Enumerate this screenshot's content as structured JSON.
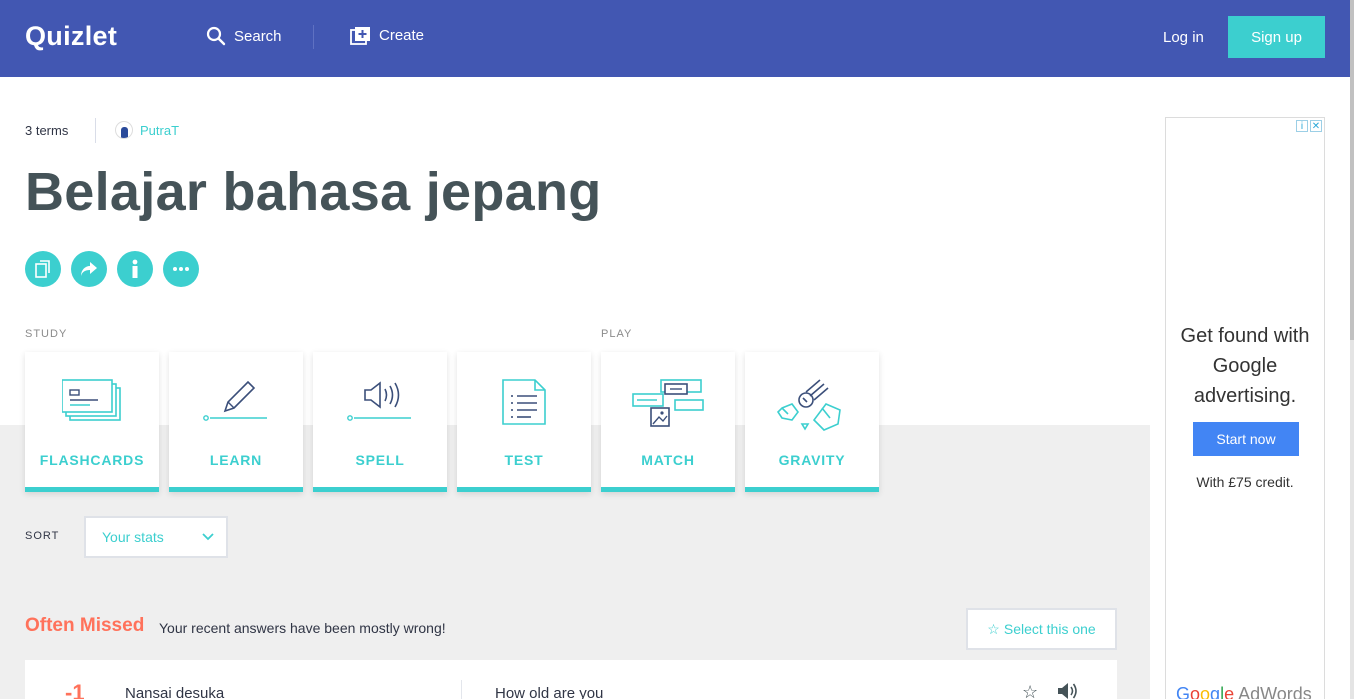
{
  "header": {
    "logo": "Quizlet",
    "search_label": "Search",
    "create_label": "Create",
    "login_label": "Log in",
    "signup_label": "Sign up"
  },
  "set": {
    "terms_count": "3 terms",
    "author": "PutraT",
    "title": "Belajar bahasa jepang"
  },
  "sections": {
    "study": "STUDY",
    "play": "PLAY"
  },
  "modes": {
    "flashcards": "FLASHCARDS",
    "learn": "LEARN",
    "spell": "SPELL",
    "test": "TEST",
    "match": "MATCH",
    "gravity": "GRAVITY"
  },
  "sort": {
    "label": "SORT",
    "selected": "Your stats"
  },
  "often_missed": {
    "title": "Often Missed",
    "subtitle": "Your recent answers have been mostly wrong!",
    "select_button": "Select this one"
  },
  "term_row": {
    "count": "-1",
    "word": "Nansai desuka",
    "definition": "How old are you"
  },
  "ad": {
    "headline": "Get found with Google advertising.",
    "button": "Start now",
    "credit": "With £75 credit.",
    "logo": "Google AdWords"
  },
  "colors": {
    "header_bg": "#4257b2",
    "accent": "#3ccfcf",
    "missed": "#ff725b",
    "title_text": "#455358"
  },
  "icons": [
    "search-icon",
    "create-icon",
    "copy-icon",
    "share-icon",
    "info-icon",
    "more-icon",
    "chevron-down-icon",
    "star-icon",
    "audio-icon"
  ]
}
